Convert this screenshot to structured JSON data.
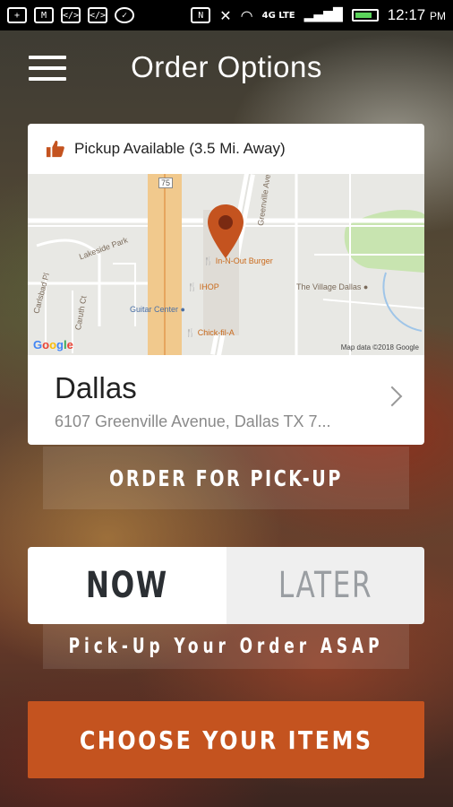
{
  "status_bar": {
    "time": "12:17",
    "ampm": "PM",
    "network": "4G LTE",
    "icons": [
      "plus-icon",
      "gmail-icon",
      "code-icon",
      "code-icon",
      "messenger-icon",
      "nfc-icon",
      "mute-icon",
      "wifi-icon",
      "signal-icon",
      "battery-icon"
    ]
  },
  "header": {
    "title": "Order Options"
  },
  "location_card": {
    "pickup_text": "Pickup Available (3.5 Mi. Away)",
    "city": "Dallas",
    "address": "6107 Greenville Avenue, Dallas TX 7..."
  },
  "map": {
    "labels": {
      "lakeside_park": "Lakeside Park",
      "greenville_ave": "Greenville Ave",
      "in_n_out": "In-N-Out Burger",
      "ihop": "IHOP",
      "guitar_center": "Guitar Center",
      "chick_fil_a": "Chick-fil-A",
      "village_dallas": "The Village Dallas",
      "carlsbad_pl": "Carlsbad Pl",
      "caruth_ct": "Caruth Ct",
      "hwy_75": "75"
    },
    "google": "Google",
    "attribution": "Map data ©2018 Google"
  },
  "buttons": {
    "order_pickup": "ORDER FOR PICK-UP",
    "choose_items": "CHOOSE YOUR ITEMS"
  },
  "toggle": {
    "now": "NOW",
    "later": "LATER",
    "selected": "NOW"
  },
  "asap_text": "Pick-Up Your Order ASAP",
  "colors": {
    "accent": "#c4531f",
    "pin": "#c4531f",
    "thumb": "#c4531f"
  }
}
